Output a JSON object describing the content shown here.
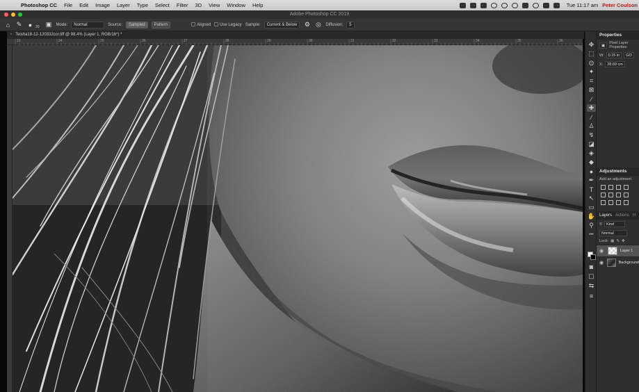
{
  "menubar": {
    "app_name": "Photoshop CC",
    "menus": [
      "File",
      "Edit",
      "Image",
      "Layer",
      "Type",
      "Select",
      "Filter",
      "3D",
      "View",
      "Window",
      "Help"
    ],
    "clock": "Tue 11:17 am",
    "user": "Peter Coulson"
  },
  "window": {
    "title": "Adobe Photoshop CC 2019",
    "traffic_colors": [
      "#ff5f57",
      "#febc2e",
      "#28c840"
    ]
  },
  "options_bar": {
    "brush_size": "20",
    "mode_label": "Mode:",
    "mode_value": "Normal",
    "source_label": "Source:",
    "source_sampled": "Sampled",
    "source_pattern": "Pattern",
    "aligned_label": "Aligned",
    "use_legacy_label": "Use Legacy",
    "sample_label": "Sample:",
    "sample_value": "Current & Below",
    "diffusion_label": "Diffusion:",
    "diffusion_value": "5"
  },
  "document": {
    "tab_title": "Teisha18-12-120332ccr.tiff @ 98.4% (Layer 1, RGB/16*) *",
    "ruler_labels": [
      "23",
      "24",
      "25",
      "26",
      "27",
      "28",
      "29",
      "30",
      "31",
      "32",
      "33",
      "34",
      "35",
      "36"
    ]
  },
  "toolbar": {
    "tools": [
      {
        "icon": "move-tool-icon",
        "glyph": "✥"
      },
      {
        "icon": "marquee-tool-icon",
        "glyph": "⬚"
      },
      {
        "icon": "lasso-tool-icon",
        "glyph": "ʘ"
      },
      {
        "icon": "magic-wand-tool-icon",
        "glyph": "✦"
      },
      {
        "icon": "crop-tool-icon",
        "glyph": "⌗"
      },
      {
        "icon": "frame-tool-icon",
        "glyph": "⊠"
      },
      {
        "icon": "eyedropper-tool-icon",
        "glyph": "⁄"
      },
      {
        "icon": "healing-brush-tool-icon",
        "glyph": "✚",
        "active": true
      },
      {
        "icon": "brush-tool-icon",
        "glyph": "⁄"
      },
      {
        "icon": "clone-stamp-tool-icon",
        "glyph": "♙"
      },
      {
        "icon": "history-brush-tool-icon",
        "glyph": "↯"
      },
      {
        "icon": "eraser-tool-icon",
        "glyph": "◪"
      },
      {
        "icon": "paint-bucket-tool-icon",
        "glyph": "◈"
      },
      {
        "icon": "blur-tool-icon",
        "glyph": "◆"
      },
      {
        "icon": "dodge-tool-icon",
        "glyph": "●"
      },
      {
        "icon": "pen-tool-icon",
        "glyph": "✒"
      },
      {
        "icon": "type-tool-icon",
        "glyph": "T"
      },
      {
        "icon": "path-selection-tool-icon",
        "glyph": "↖"
      },
      {
        "icon": "rectangle-tool-icon",
        "glyph": "▭"
      },
      {
        "icon": "hand-tool-icon",
        "glyph": "✋"
      },
      {
        "icon": "zoom-tool-icon",
        "glyph": "⚲"
      },
      {
        "icon": "more-tools-icon",
        "glyph": "•••"
      }
    ]
  },
  "properties": {
    "title": "Properties",
    "layer_type": "Pixel Layer Properties",
    "w_label": "W:",
    "w_value": "0.15 in",
    "x_label": "X:",
    "x_value": "28.69 cm",
    "go_label": "GO"
  },
  "adjustments": {
    "title": "Adjustments",
    "subtitle": "Add an adjustment"
  },
  "layers_panel": {
    "tabs": [
      "Layers",
      "Actions",
      "H"
    ],
    "kind_label": "Kind",
    "blend_mode": "Normal",
    "lock_label": "Lock:",
    "layers": [
      {
        "name": "Layer 1",
        "selected": true
      },
      {
        "name": "Background",
        "selected": false
      }
    ]
  }
}
